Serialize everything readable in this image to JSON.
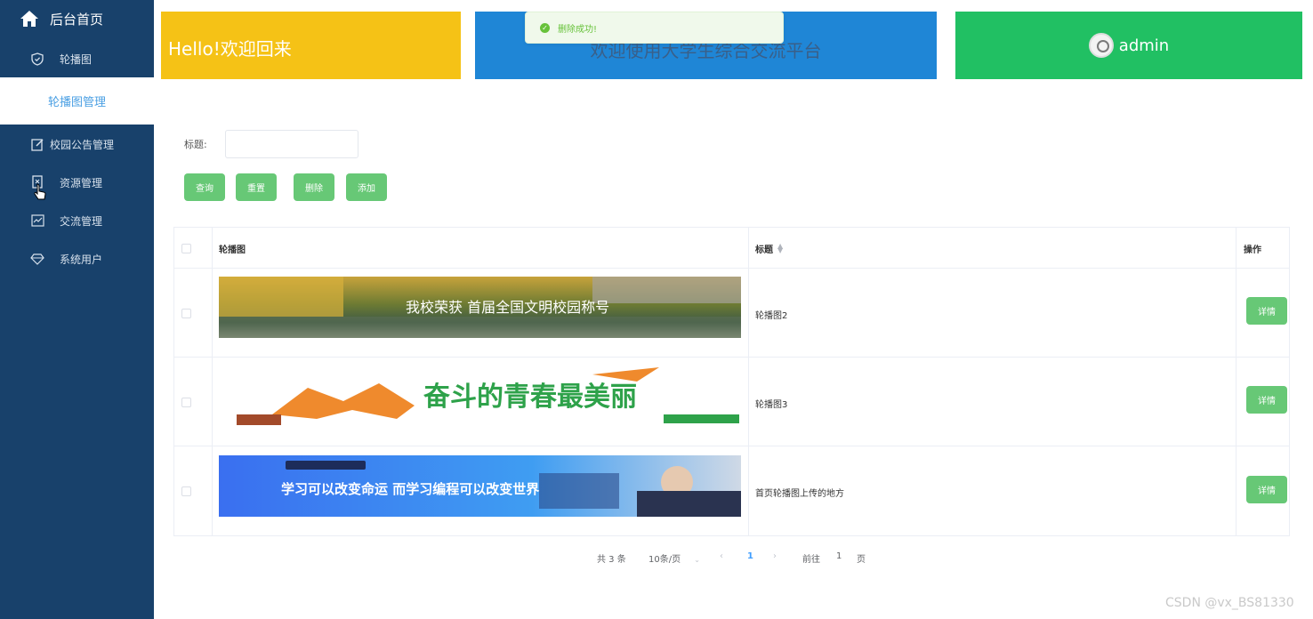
{
  "sidebar": {
    "home_label": "后台首页",
    "items": [
      {
        "label": "轮播图",
        "icon": "shield-check-icon"
      },
      {
        "label": "轮播图管理",
        "active": true
      },
      {
        "label": "校园公告管理",
        "icon": "edit-icon"
      },
      {
        "label": "资源管理",
        "icon": "document-icon"
      },
      {
        "label": "交流管理",
        "icon": "chart-icon"
      },
      {
        "label": "系统用户",
        "icon": "diamond-icon"
      }
    ]
  },
  "header": {
    "welcome": "Hello!欢迎回来",
    "platform_title": "欢迎使用大学生综合交流平台",
    "username": "admin"
  },
  "toast": {
    "message": "删除成功!",
    "type": "success"
  },
  "search": {
    "label": "标题:",
    "value": ""
  },
  "buttons": {
    "query": "查询",
    "reset": "重置",
    "delete": "删除",
    "add": "添加"
  },
  "table": {
    "columns": {
      "image": "轮播图",
      "title": "标题",
      "action": "操作"
    },
    "rows": [
      {
        "title": "轮播图2",
        "action": "详情",
        "banner_text": "我校荣获 首届全国文明校园称号"
      },
      {
        "title": "轮播图3",
        "action": "详情",
        "banner_text": "奋斗的青春最美丽"
      },
      {
        "title": "首页轮播图上传的地方",
        "action": "详情",
        "banner_text": "学习可以改变命运 而学习编程可以改变世界"
      }
    ]
  },
  "pagination": {
    "total": "共 3 条",
    "page_size": "10条/页",
    "current_page": "1",
    "goto_label": "前往",
    "goto_value": "1",
    "page_suffix": "页"
  },
  "watermark": "CSDN @vx_BS81330",
  "colors": {
    "sidebar": "#18416b",
    "yellow_card": "#f5c216",
    "blue_card": "#1f86d6",
    "green_card": "#21c063",
    "button": "#67c876",
    "link_active": "#4a9fe3"
  }
}
